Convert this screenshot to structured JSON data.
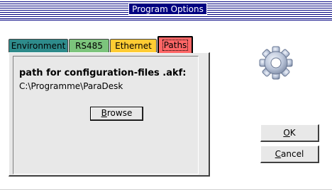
{
  "window": {
    "title": "Program Options"
  },
  "tabs": [
    {
      "label": "Environment",
      "color": "#2e8b8b",
      "selected": false
    },
    {
      "label": "RS485",
      "color": "#7cc47c",
      "selected": false
    },
    {
      "label": "Ethernet",
      "color": "#ffcc33",
      "selected": false
    },
    {
      "label": "Paths",
      "color": "#ff6666",
      "selected": true
    }
  ],
  "paths_panel": {
    "heading": "path for configuration-files .akf:",
    "path_value": "C:\\Programme\\ParaDesk",
    "browse_mnemonic": "B",
    "browse_rest": "rowse"
  },
  "buttons": {
    "ok_mnemonic": "O",
    "ok_rest": "K",
    "cancel_mnemonic": "C",
    "cancel_rest": "ancel"
  },
  "icons": {
    "settings": "gear-icon"
  }
}
